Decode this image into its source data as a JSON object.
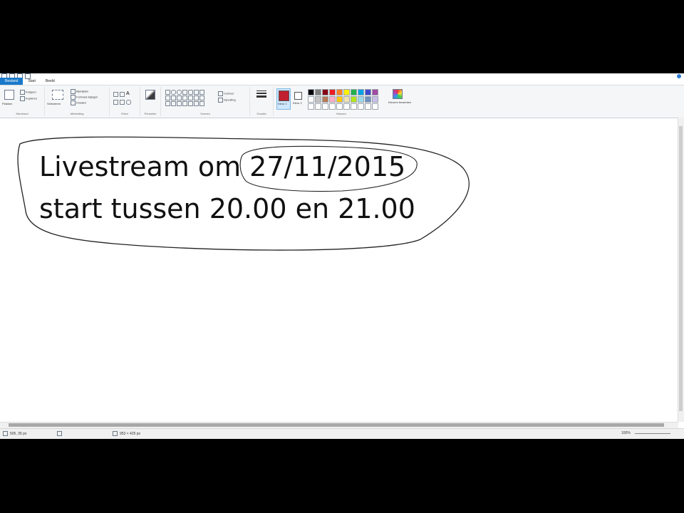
{
  "app": {
    "name": "Paint"
  },
  "tabs": [
    {
      "label": "Bestand"
    },
    {
      "label": "Start"
    },
    {
      "label": "Beeld"
    }
  ],
  "ribbon": {
    "groups": {
      "klembord": {
        "label": "Klembord",
        "paste": "Plakken",
        "cut": "Knippen",
        "copy": "Kopiëren"
      },
      "afbeelding": {
        "label": "Afbeelding",
        "select": "Selecteren",
        "crop": "Bijsnijden",
        "resize": "Formaat wijzigen",
        "rotate": "Draaien"
      },
      "extra": {
        "label": "Extra"
      },
      "penselen": {
        "label": "Penselen"
      },
      "vormen": {
        "label": "Vormen",
        "outline": "Contour",
        "fill": "Opvulling"
      },
      "grootte": {
        "label": "Grootte"
      },
      "kleuren": {
        "label": "Kleuren",
        "color1": "Kleur 1",
        "color2": "Kleur 2",
        "edit": "Kleuren bewerken"
      }
    },
    "palette": [
      "#000000",
      "#7f7f7f",
      "#880015",
      "#ed1c24",
      "#ff7f27",
      "#fff200",
      "#22b14c",
      "#00a2e8",
      "#3f48cc",
      "#a349a4",
      "#ffffff",
      "#c3c3c3",
      "#b97a57",
      "#ffaec9",
      "#ffc90e",
      "#efe4b0",
      "#b5e61d",
      "#99d9ea",
      "#7092be",
      "#c8bfe7"
    ],
    "color1_value": "#c0202f",
    "color2_value": "#ffffff"
  },
  "canvas": {
    "line1": "Livestream om 27/11/2015",
    "line2": "start tussen 20.00 en 21.00"
  },
  "status": {
    "position": "505, 35 px",
    "selection": "",
    "size": "953 × 425 px",
    "zoom": "100%"
  }
}
